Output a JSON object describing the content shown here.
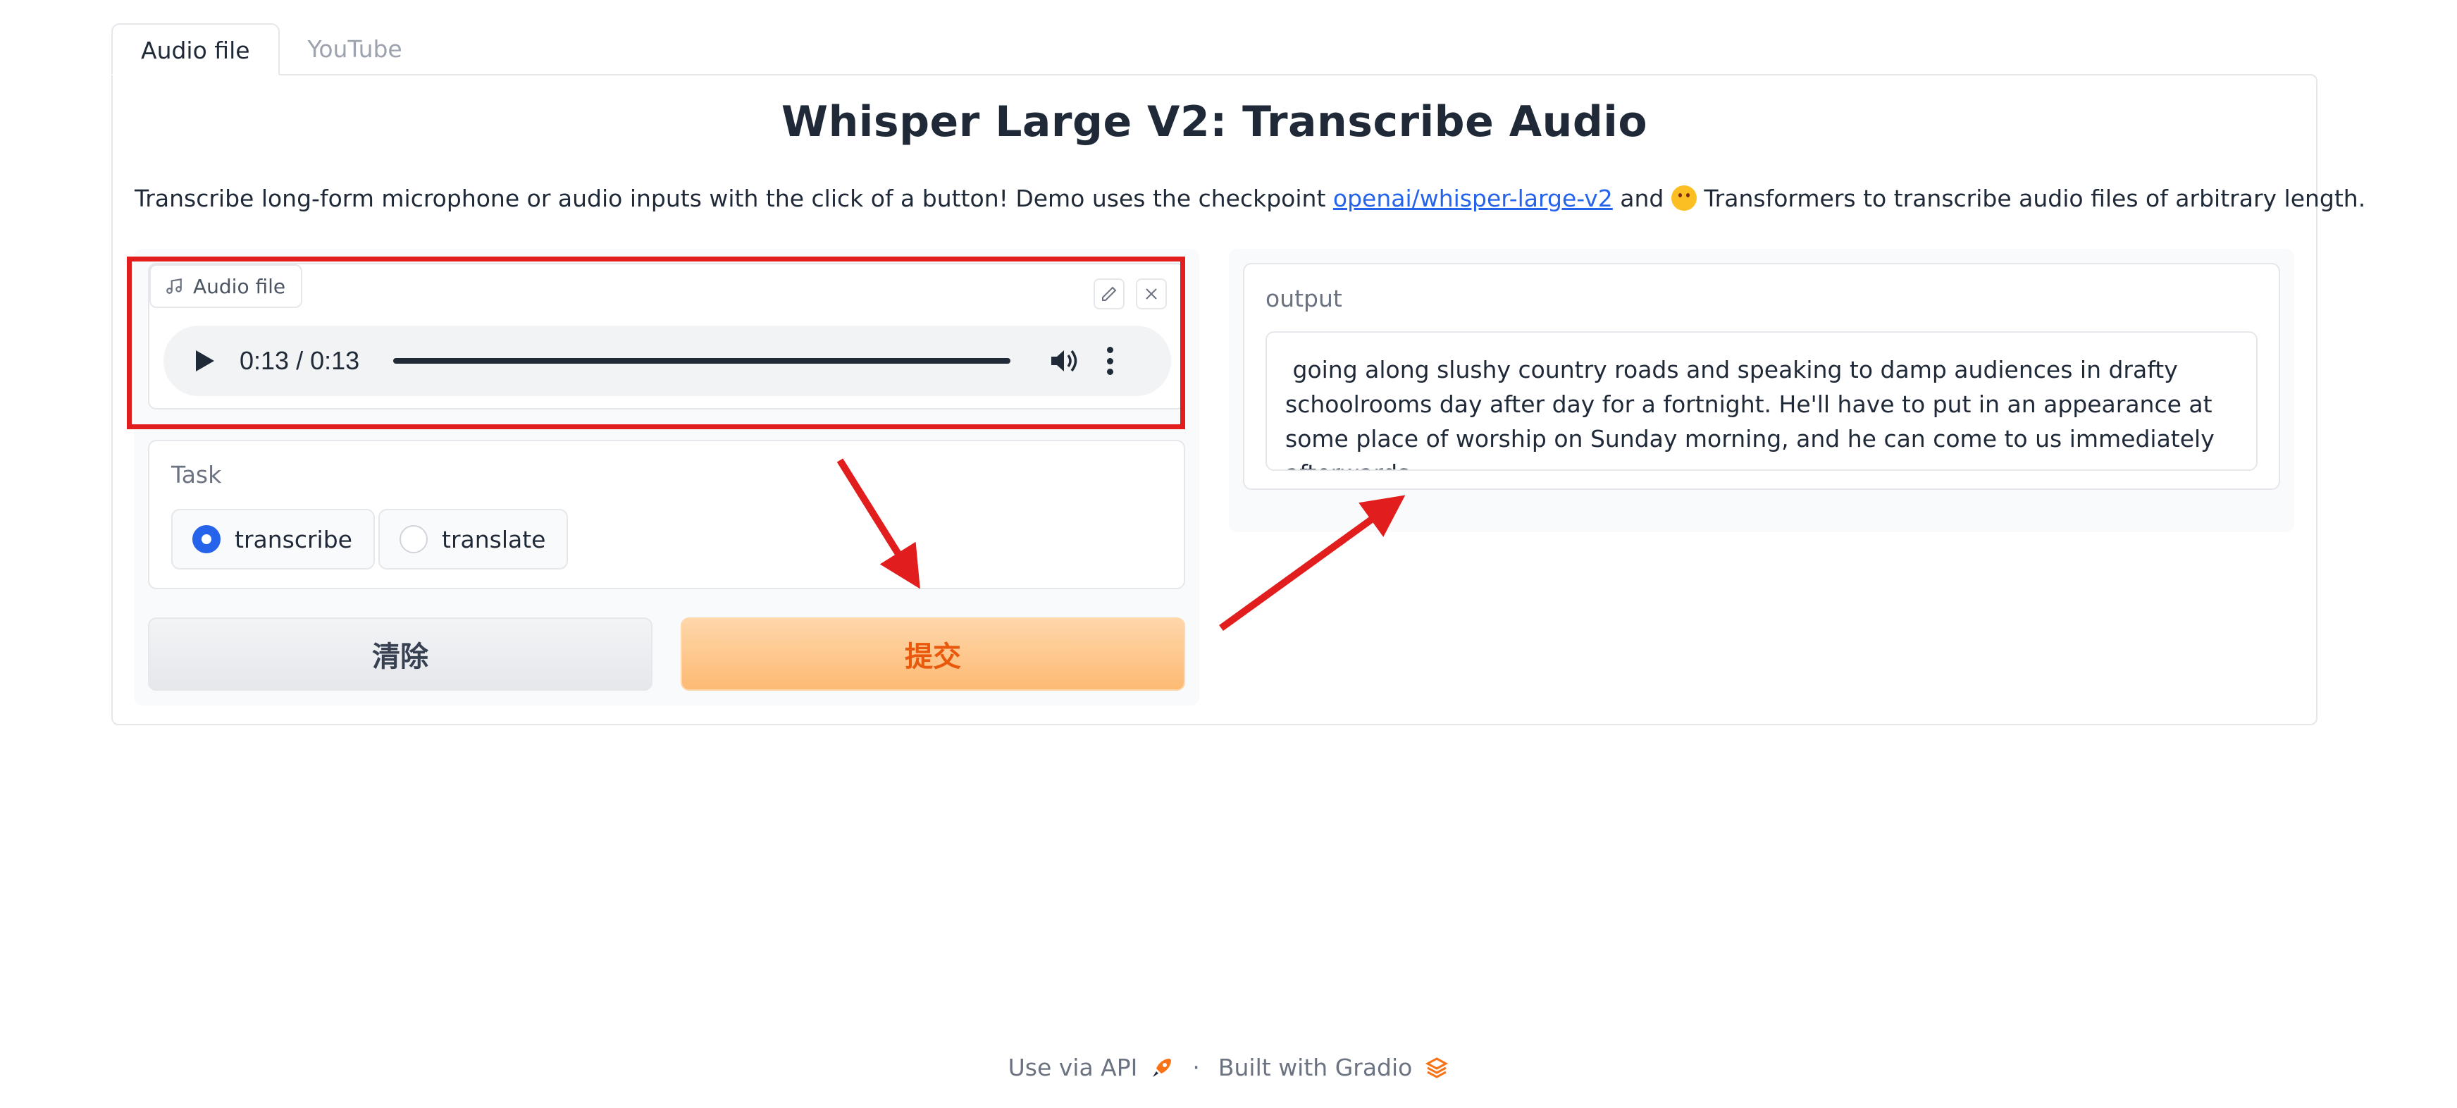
{
  "tabs": [
    {
      "label": "Audio file",
      "active": true
    },
    {
      "label": "YouTube",
      "active": false
    }
  ],
  "title": "Whisper Large V2: Transcribe Audio",
  "description": {
    "before_link": "Transcribe long-form microphone or audio inputs with the click of a button! Demo uses the checkpoint ",
    "link_text": "openai/whisper-large-v2",
    "after_link": " and ",
    "after_emoji": " Transformers to transcribe audio files of arbitrary length."
  },
  "audio": {
    "label": "Audio file",
    "time": "0:13 / 0:13",
    "icon": "music-note-icon"
  },
  "task": {
    "label": "Task",
    "options": [
      {
        "label": "transcribe",
        "checked": true
      },
      {
        "label": "translate",
        "checked": false
      }
    ]
  },
  "buttons": {
    "clear": "清除",
    "submit": "提交"
  },
  "output": {
    "label": "output",
    "text": " going along slushy country roads and speaking to damp audiences in drafty schoolrooms day after day for a fortnight. He'll have to put in an appearance at some place of worship on Sunday morning, and he can come to us immediately afterwards."
  },
  "footer": {
    "api": "Use via API",
    "dot": "·",
    "built": "Built with Gradio"
  },
  "colors": {
    "accent_orange": "#ea580c",
    "link_blue": "#2563eb",
    "annotation_red": "#e11d1d"
  }
}
